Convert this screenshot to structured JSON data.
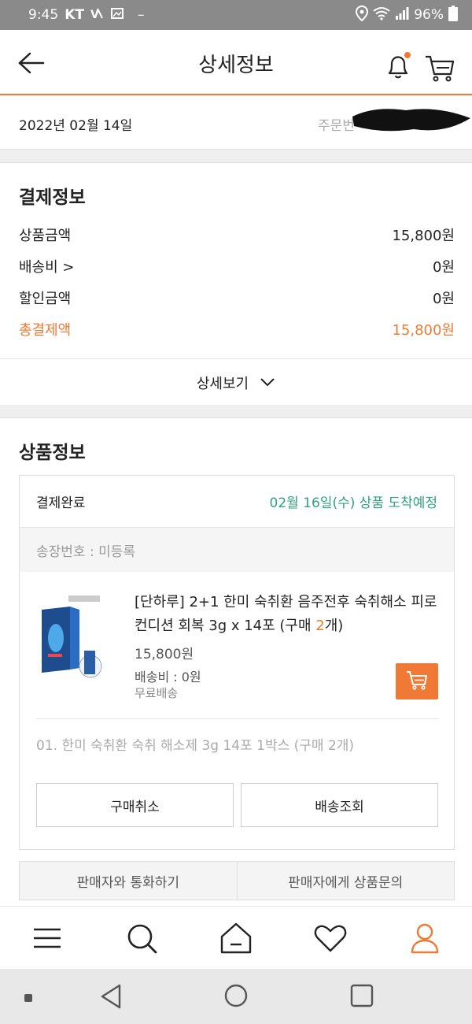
{
  "status_bar": {
    "time": "9:45",
    "carrier": "KT",
    "battery": "96%"
  },
  "header": {
    "title": "상세정보"
  },
  "order": {
    "date": "2022년 02월 14일",
    "number_label": "주문번"
  },
  "payment": {
    "title": "결제정보",
    "rows": [
      {
        "label": "상품금액",
        "value": "15,800원"
      },
      {
        "label": "배송비 >",
        "value": "0원"
      },
      {
        "label": "할인금액",
        "value": "0원"
      },
      {
        "label": "총결제액",
        "value": "15,800원"
      }
    ],
    "detail_label": "상세보기"
  },
  "product": {
    "title": "상품정보",
    "status": "결제완료",
    "eta": "02월 16일(수) 상품 도착예정",
    "invoice": "송장번호 : 미등록",
    "name_prefix": "[단하루] 2+1 한미 숙취환 음주전후 숙취해소 피로컨디션 회복 3g x 14포 (구매 ",
    "name_qty": "2",
    "name_suffix": "개)",
    "price": "15,800원",
    "shipping": "배송비 : 0원",
    "free_shipping": "무료배송",
    "option": "01. 한미 숙취환 숙취 해소제 3g 14포 1박스 (구매 2개)",
    "cancel_label": "구매취소",
    "track_label": "배송조회",
    "call_seller_label": "판매자와 통화하기",
    "ask_seller_label": "판매자에게 상품문의"
  },
  "colors": {
    "accent": "#f07a35",
    "eta_green": "#2fa37a"
  },
  "icons": [
    "back-arrow-icon",
    "bell-icon",
    "cart-icon",
    "menu-icon",
    "search-icon",
    "home-icon",
    "heart-icon",
    "user-icon"
  ]
}
